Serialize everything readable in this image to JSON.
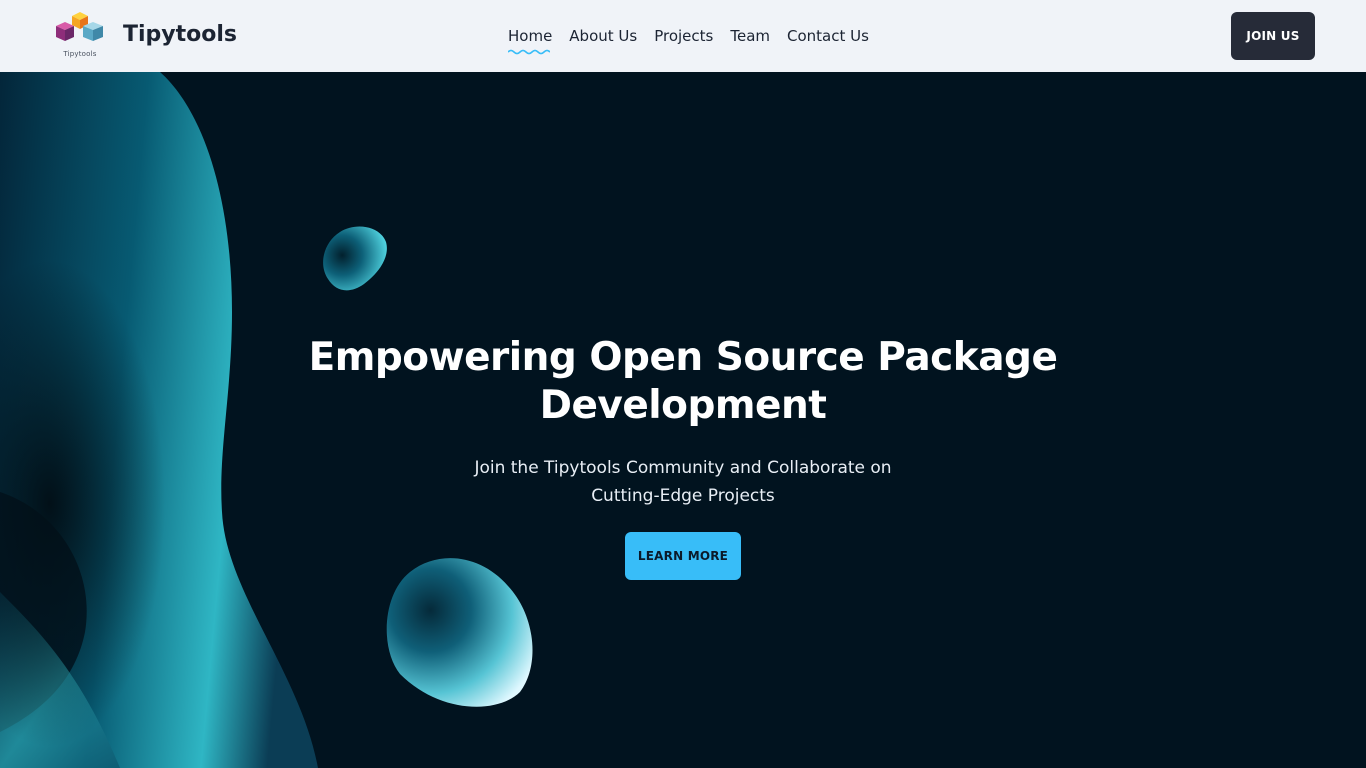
{
  "header": {
    "logo_caption": "Tipytools",
    "brand": "Tipytools",
    "nav": [
      {
        "label": "Home",
        "active": true
      },
      {
        "label": "About Us"
      },
      {
        "label": "Projects"
      },
      {
        "label": "Team"
      },
      {
        "label": "Contact Us"
      }
    ],
    "join_label": "JOIN US"
  },
  "hero": {
    "title_line1": "Empowering Open Source Package",
    "title_line2": "Development",
    "subtitle_line1": "Join the Tipytools Community and Collaborate on",
    "subtitle_line2": "Cutting-Edge Projects",
    "cta_label": "LEARN MORE"
  },
  "colors": {
    "header_bg": "#f0f3f8",
    "hero_bg": "#01131f",
    "accent": "#38bdf8",
    "join_button_bg": "#262b38",
    "nav_active_underline": "#38bdf8"
  },
  "icons": {
    "logo": "stacked-cubes-icon",
    "active_nav_indicator": "wavy-underline-icon"
  }
}
